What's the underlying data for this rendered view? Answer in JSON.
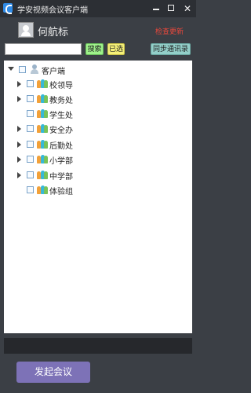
{
  "window": {
    "title": "学安视频会议客户端",
    "controls": {
      "minimize": "",
      "maximize": "",
      "close": "✕"
    }
  },
  "user": {
    "name": "何航标",
    "check_update": "检查更新"
  },
  "toolbar": {
    "search_value": "",
    "search_button": "搜索",
    "selected_button": "已选",
    "sync_button": "同步通讯录"
  },
  "tree": {
    "root": {
      "label": "客户端",
      "expanded": true
    },
    "items": [
      {
        "label": "校领导",
        "expandable": true
      },
      {
        "label": "教务处",
        "expandable": true
      },
      {
        "label": "学生处",
        "expandable": false
      },
      {
        "label": "安全办",
        "expandable": true
      },
      {
        "label": "后勤处",
        "expandable": true
      },
      {
        "label": "小学部",
        "expandable": true
      },
      {
        "label": "中学部",
        "expandable": true
      },
      {
        "label": "体验组",
        "expandable": false
      }
    ]
  },
  "footer": {
    "start_meeting": "发起会议"
  },
  "colors": {
    "background": "#3b3f45",
    "search_button": "#9ff28b",
    "selected_button": "#f5f078",
    "sync_button": "#93cfc9",
    "start_meeting": "#7d72b7",
    "check_update": "#e8483c"
  }
}
